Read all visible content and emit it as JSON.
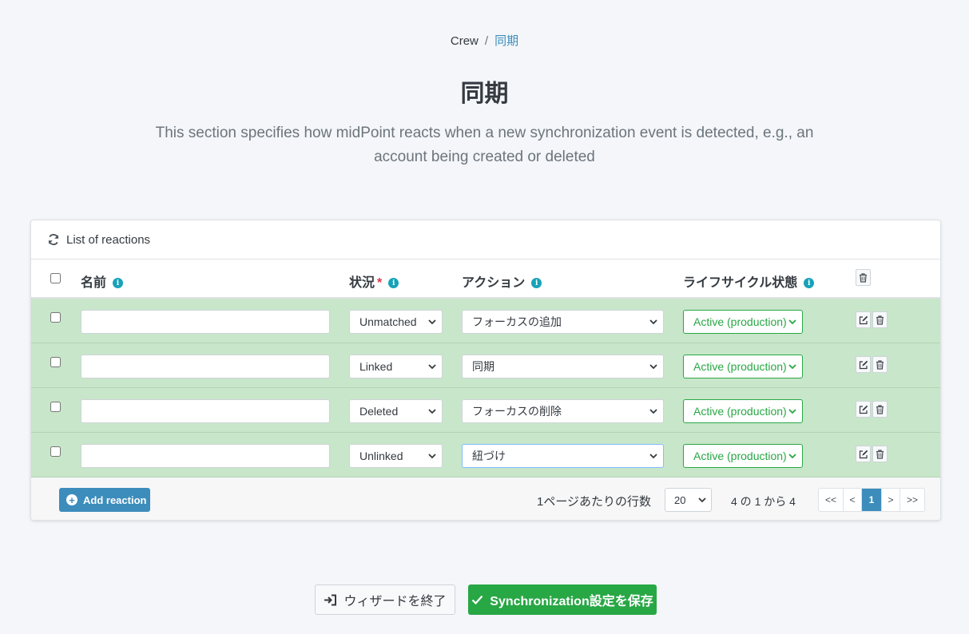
{
  "breadcrumb": {
    "parent": "Crew",
    "separator": "/",
    "current": "同期"
  },
  "page": {
    "title": "同期",
    "description": "This section specifies how midPoint reacts when a new synchronization event is detected, e.g., an account being created or deleted"
  },
  "card": {
    "header": "List of reactions",
    "columns": {
      "name": "名前",
      "situation": "状況",
      "action": "アクション",
      "lifecycle": "ライフサイクル状態"
    },
    "rows": [
      {
        "name": "",
        "situation": "Unmatched",
        "action": "フォーカスの追加",
        "lifecycle": "Active (production)"
      },
      {
        "name": "",
        "situation": "Linked",
        "action": "同期",
        "lifecycle": "Active (production)"
      },
      {
        "name": "",
        "situation": "Deleted",
        "action": "フォーカスの削除",
        "lifecycle": "Active (production)"
      },
      {
        "name": "",
        "situation": "Unlinked",
        "action": "紐づけ",
        "lifecycle": "Active (production)"
      }
    ],
    "footer": {
      "add_label": "Add reaction",
      "rows_per_page_label": "1ページあたりの行数",
      "rows_per_page": "20",
      "count_text": "4 の 1 から 4",
      "pages": [
        "<<",
        "<",
        "1",
        ">",
        ">>"
      ]
    }
  },
  "buttons": {
    "exit": "ウィザードを終了",
    "save": "Synchronization設定を保存"
  },
  "colors": {
    "accent": "#3c8dbc",
    "row_bg": "#c8e6c9",
    "success": "#28a745",
    "info": "#17a2b8",
    "required": "#dc3545"
  },
  "icons": {
    "header": "refresh-icon",
    "info": "info-icon",
    "edit": "edit-icon",
    "delete": "trash-icon",
    "exit": "sign-out-icon",
    "save": "check-icon",
    "add": "plus-circle-icon"
  }
}
